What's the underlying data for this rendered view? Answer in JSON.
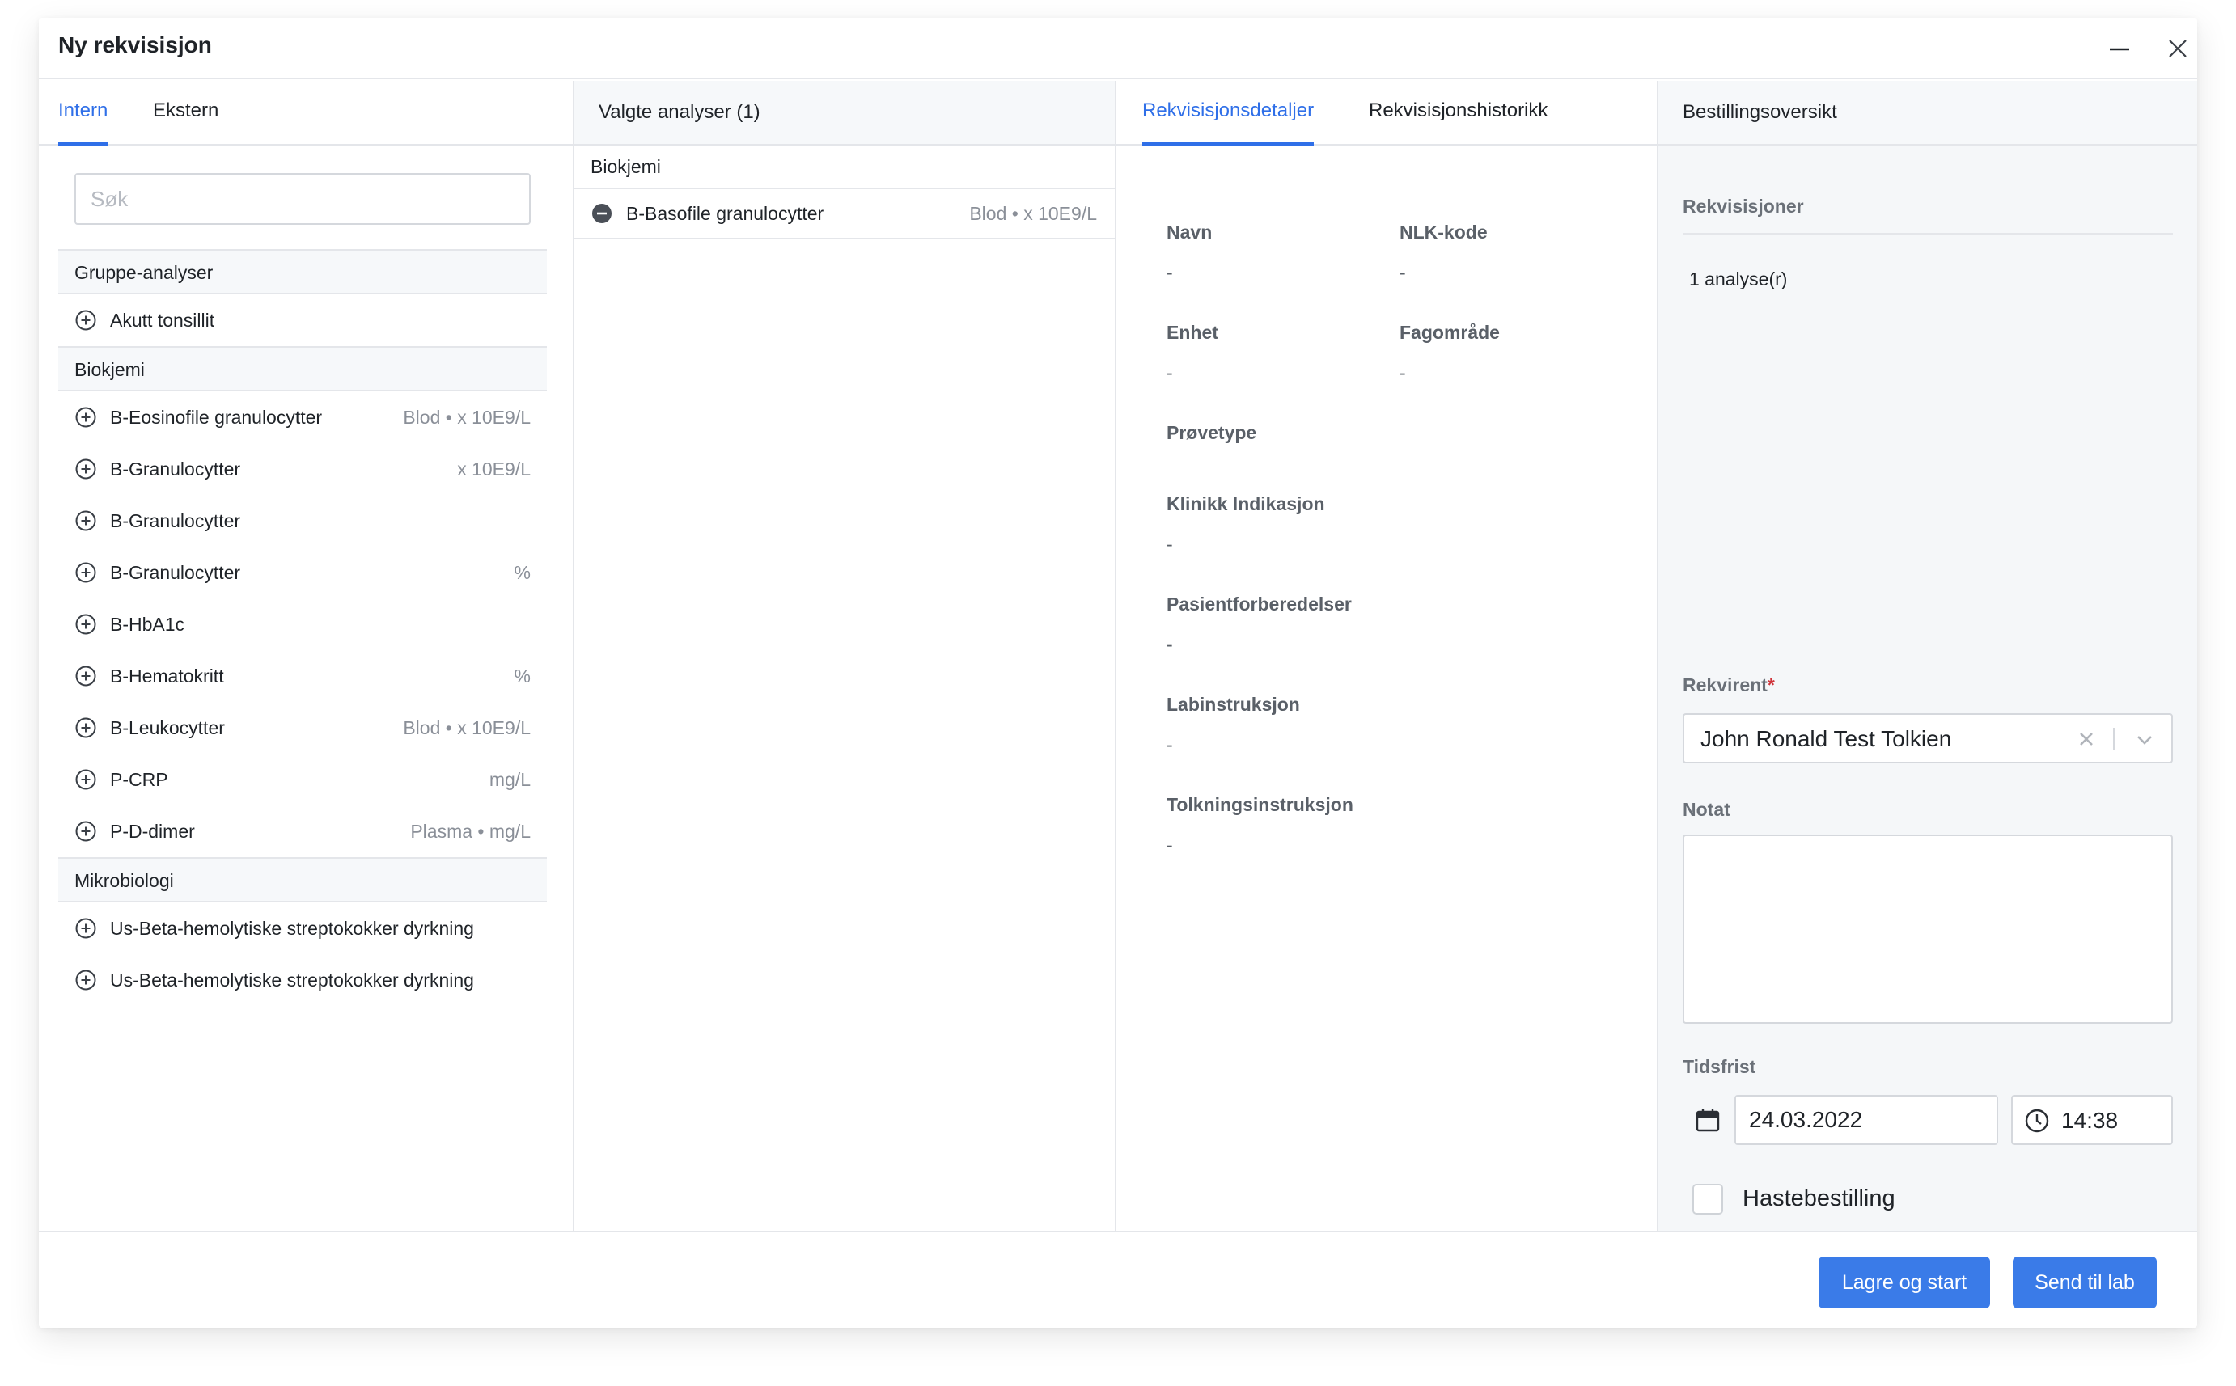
{
  "window": {
    "title": "Ny rekvisisjon"
  },
  "left": {
    "tabs": [
      "Intern",
      "Ekstern"
    ],
    "search_placeholder": "Søk",
    "groups": [
      {
        "title": "Gruppe-analyser",
        "items": [
          {
            "name": "Akutt tonsillit",
            "meta": ""
          }
        ]
      },
      {
        "title": "Biokjemi",
        "items": [
          {
            "name": "B-Eosinofile granulocytter",
            "meta": "Blod • x 10E9/L"
          },
          {
            "name": "B-Granulocytter",
            "meta": "x 10E9/L"
          },
          {
            "name": "B-Granulocytter",
            "meta": ""
          },
          {
            "name": "B-Granulocytter",
            "meta": "%"
          },
          {
            "name": "B-HbA1c",
            "meta": ""
          },
          {
            "name": "B-Hematokritt",
            "meta": "%"
          },
          {
            "name": "B-Leukocytter",
            "meta": "Blod • x 10E9/L"
          },
          {
            "name": "P-CRP",
            "meta": "mg/L"
          },
          {
            "name": "P-D-dimer",
            "meta": "Plasma • mg/L"
          }
        ]
      },
      {
        "title": "Mikrobiologi",
        "items": [
          {
            "name": "Us-Beta-hemolytiske streptokokker dyrkning",
            "meta": ""
          },
          {
            "name": "Us-Beta-hemolytiske streptokokker dyrkning",
            "meta": ""
          }
        ]
      }
    ]
  },
  "selected": {
    "header": "Valgte analyser (1)",
    "group": "Biokjemi",
    "item": {
      "name": "B-Basofile granulocytter",
      "meta": "Blod • x 10E9/L"
    }
  },
  "details": {
    "tabs": [
      "Rekvisisjonsdetaljer",
      "Rekvisisjonshistorikk"
    ],
    "fields": {
      "navn": {
        "label": "Navn",
        "value": "-"
      },
      "nlk": {
        "label": "NLK-kode",
        "value": "-"
      },
      "enhet": {
        "label": "Enhet",
        "value": "-"
      },
      "fagomrade": {
        "label": "Fagområde",
        "value": "-"
      },
      "provetype": {
        "label": "Prøvetype",
        "value": ""
      },
      "klinikk": {
        "label": "Klinikk Indikasjon",
        "value": "-"
      },
      "pasient": {
        "label": "Pasientforberedelser",
        "value": "-"
      },
      "labinstruksjon": {
        "label": "Labinstruksjon",
        "value": "-"
      },
      "tolkning": {
        "label": "Tolkningsinstruksjon",
        "value": "-"
      }
    }
  },
  "order": {
    "header": "Bestillingsoversikt",
    "section_label": "Rekvisisjoner",
    "count_text": "1 analyse(r)",
    "rekvirent_label": "Rekvirent",
    "rekvirent_required": "*",
    "rekvirent_value": "John Ronald Test Tolkien",
    "notat_label": "Notat",
    "tidsfrist_label": "Tidsfrist",
    "date_value": "24.03.2022",
    "time_value": "14:38",
    "urgent_label": "Hastebestilling"
  },
  "footer": {
    "save_label": "Lagre og start",
    "send_label": "Send til lab"
  },
  "colors": {
    "accent": "#2f6fe8",
    "button": "#3a7be8",
    "required": "#d0343a"
  }
}
